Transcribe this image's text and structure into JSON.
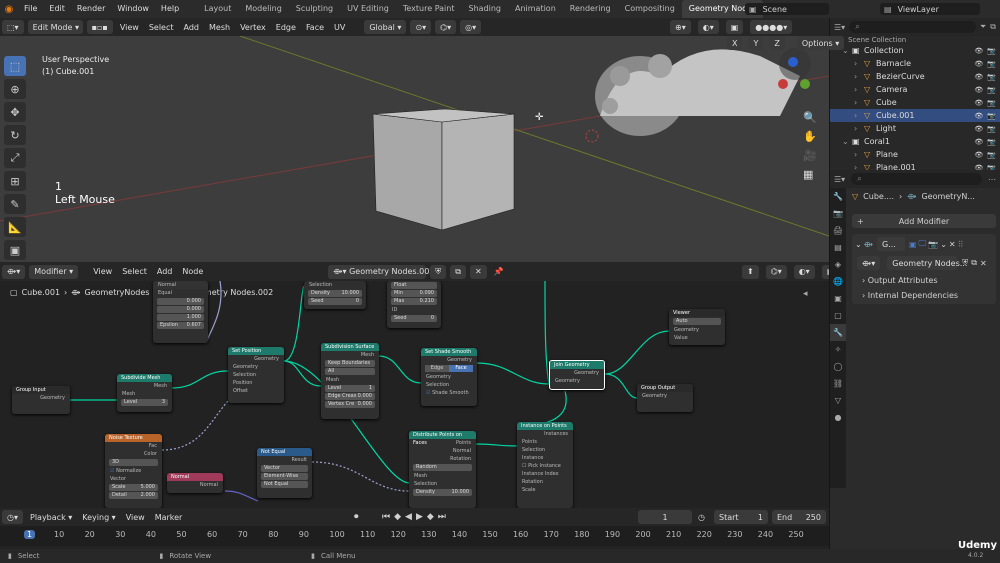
{
  "topbar": {
    "menus": [
      "File",
      "Edit",
      "Render",
      "Window",
      "Help"
    ],
    "workspaces": [
      "Layout",
      "Modeling",
      "Sculpting",
      "UV Editing",
      "Texture Paint",
      "Shading",
      "Animation",
      "Rendering",
      "Compositing",
      "Geometry Nodes",
      "Scripting"
    ],
    "active_workspace": "Geometry Nodes",
    "scene": "Scene",
    "view_layer": "ViewLayer"
  },
  "viewport_header": {
    "mode": "Edit Mode",
    "menus": [
      "View",
      "Select",
      "Add",
      "Mesh",
      "Vertex",
      "Edge",
      "Face",
      "UV"
    ],
    "orientation": "Global",
    "axes": [
      "X",
      "Y",
      "Z"
    ],
    "options": "Options"
  },
  "viewport": {
    "perspective": "User Perspective",
    "object_label": "(1) Cube.001",
    "keystroke_count": "1",
    "keystroke": "Left Mouse"
  },
  "node_editor_header": {
    "editor_type": "Modifier",
    "menus": [
      "View",
      "Select",
      "Add",
      "Node"
    ],
    "node_group": "Geometry Nodes.002"
  },
  "node_breadcrumb": {
    "object": "Cube.001",
    "modifier": "GeometryNodes",
    "group": "Geometry Nodes.002"
  },
  "nodes": {
    "group_input": {
      "title": "Group Input",
      "out": "Geometry"
    },
    "subdivide_mesh": {
      "title": "Subdivide Mesh",
      "mesh_out": "Mesh",
      "mesh_in": "Mesh",
      "level": "Level",
      "level_val": "3"
    },
    "set_position": {
      "title": "Set Position",
      "out": "Geometry",
      "in1": "Geometry",
      "in2": "Selection",
      "in3": "Position",
      "in4": "Offset"
    },
    "subdivision_surface": {
      "title": "Subdivision Surface",
      "out": "Mesh",
      "opt1": "Keep Boundaries",
      "opt2": "All",
      "in": "Mesh",
      "level": "Level",
      "level_val": "1",
      "crease": "Edge Creas",
      "crease_val": "0.000",
      "vcrease": "Vertex Cre",
      "vcrease_val": "0.000"
    },
    "set_shade_smooth": {
      "title": "Set Shade Smooth",
      "out": "Geometry",
      "tab1": "Edge",
      "tab2": "Face",
      "in1": "Geometry",
      "in2": "Selection",
      "chk": "Shade Smooth"
    },
    "join_geometry": {
      "title": "Join Geometry",
      "out": "Geometry",
      "in": "Geometry"
    },
    "viewer": {
      "title": "Viewer",
      "mode": "Auto",
      "in1": "Geometry",
      "in2": "Value"
    },
    "group_output": {
      "title": "Group Output",
      "in": "Geometry"
    },
    "noise_texture": {
      "title": "Noise Texture",
      "fac": "Fac",
      "color": "Color",
      "dim": "3D",
      "normalize": "Normalize",
      "vector": "Vector",
      "scale": "Scale",
      "scale_val": "5.000",
      "detail": "Detail",
      "detail_val": "2.000"
    },
    "normal": {
      "title": "Normal",
      "out": "Normal"
    },
    "not_equal": {
      "title": "Not Equal",
      "result": "Result",
      "opt1": "Vector",
      "opt2": "Element-Wise",
      "opt3": "Not Equal"
    },
    "distribute": {
      "title": "Distribute Points on Faces",
      "out1": "Points",
      "out2": "Normal",
      "out3": "Rotation",
      "mode": "Random",
      "in1": "Mesh",
      "in2": "Selection",
      "density": "Density",
      "density_val": "10.000"
    },
    "instance_on_points": {
      "title": "Instance on Points",
      "out": "Instances",
      "in1": "Points",
      "in2": "Selection",
      "in3": "Instance",
      "chk": "Pick Instance",
      "in4": "Instance Index",
      "in5": "Rotation",
      "in6": "Scale"
    },
    "vector_node": {
      "vals": [
        "0.000",
        "0.000",
        "1.000"
      ],
      "epsilon": "Epsilon",
      "epsilon_val": "0.607",
      "in_label": "Normal",
      "equal": "Equal"
    },
    "selection_node": {
      "in1": "Selection",
      "dist": "Density",
      "dist_val": "10.000",
      "seed": "Seed",
      "seed_val": "0"
    },
    "random_node": {
      "mode": "Float",
      "min": "Min",
      "min_val": "0.090",
      "max": "Max",
      "max_val": "0.210",
      "dim": "ID",
      "seed": "Seed",
      "seed_val": "0"
    }
  },
  "outliner": {
    "root": "Scene Collection",
    "items": [
      {
        "name": "Collection",
        "indent": 1
      },
      {
        "name": "Barnacle",
        "indent": 2
      },
      {
        "name": "BezierCurve",
        "indent": 2
      },
      {
        "name": "Camera",
        "indent": 2
      },
      {
        "name": "Cube",
        "indent": 2
      },
      {
        "name": "Cube.001",
        "indent": 2,
        "selected": true
      },
      {
        "name": "Light",
        "indent": 2
      },
      {
        "name": "Coral1",
        "indent": 1
      },
      {
        "name": "Plane",
        "indent": 2
      },
      {
        "name": "Plane.001",
        "indent": 2
      }
    ]
  },
  "properties": {
    "breadcrumb_object": "Cube....",
    "breadcrumb_modifier": "GeometryN...",
    "add_modifier": "Add Modifier",
    "modifier_name": "G...",
    "node_group": "Geometry Nodes...",
    "output_attributes": "Output Attributes",
    "internal_dependencies": "Internal Dependencies"
  },
  "timeline": {
    "menus": [
      "Playback",
      "Keying",
      "View",
      "Marker"
    ],
    "current_frame": "1",
    "start_label": "Start",
    "start": "1",
    "end_label": "End",
    "end": "250",
    "ticks": [
      "1",
      "10",
      "20",
      "30",
      "40",
      "50",
      "60",
      "70",
      "80",
      "90",
      "100",
      "110",
      "120",
      "130",
      "140",
      "150",
      "160",
      "170",
      "180",
      "190",
      "200",
      "210",
      "220",
      "230",
      "240",
      "250"
    ]
  },
  "statusbar": {
    "select": "Select",
    "rotate": "Rotate View",
    "call_menu": "Call Menu",
    "version": "4.0.2",
    "watermark": "Udemy"
  }
}
